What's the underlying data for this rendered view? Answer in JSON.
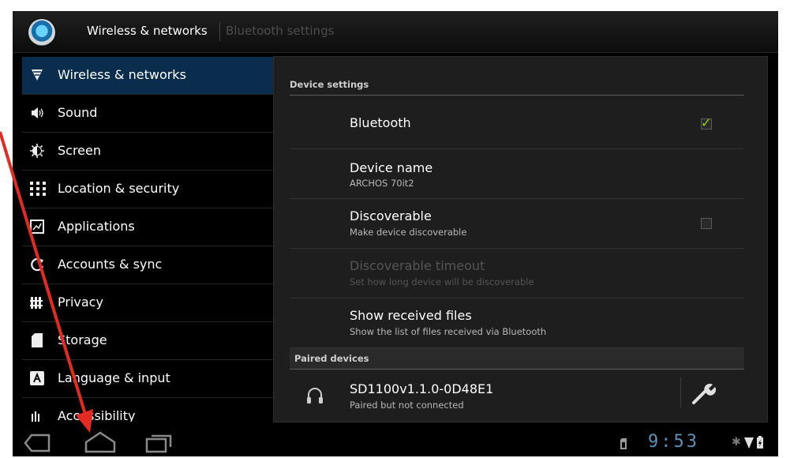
{
  "actionbar": {
    "title": "Wireless & networks",
    "subtitle": "Bluetooth settings",
    "app_icon": "settings-globe-icon"
  },
  "leftlist": {
    "items": [
      {
        "label": "Wireless & networks",
        "icon": "wifi-icon",
        "selected": true
      },
      {
        "label": "Sound",
        "icon": "speaker-icon"
      },
      {
        "label": "Screen",
        "icon": "brightness-icon"
      },
      {
        "label": "Location & security",
        "icon": "grid-icon"
      },
      {
        "label": "Applications",
        "icon": "applications-icon"
      },
      {
        "label": "Accounts & sync",
        "icon": "sync-icon"
      },
      {
        "label": "Privacy",
        "icon": "privacy-icon"
      },
      {
        "label": "Storage",
        "icon": "sdcard-icon"
      },
      {
        "label": "Language & input",
        "icon": "keyboard-icon"
      },
      {
        "label": "Accessibility",
        "icon": "accessibility-icon"
      }
    ]
  },
  "panel": {
    "device_settings_header": "Device settings",
    "bluetooth": {
      "title": "Bluetooth",
      "checked": true
    },
    "device_name": {
      "title": "Device name",
      "summary": "ARCHOS 70it2"
    },
    "discoverable": {
      "title": "Discoverable",
      "summary": "Make device discoverable",
      "checked": false
    },
    "discoverable_timeout": {
      "title": "Discoverable timeout",
      "summary": "Set how long device will be discoverable",
      "enabled": false
    },
    "received_files": {
      "title": "Show received files",
      "summary": "Show the list of files received via Bluetooth"
    },
    "paired_header": "Paired devices",
    "paired_device": {
      "name": "SD1100v1.1.0-0D48E1",
      "status": "Paired but not connected",
      "icon": "headset-icon",
      "settings_icon": "wrench-icon"
    }
  },
  "navbar": {
    "back_icon": "back-icon",
    "home_icon": "home-icon",
    "recents_icon": "recent-apps-icon",
    "clock": "9:53",
    "status_icons": [
      "sdcard-notification-icon",
      "bluetooth-icon",
      "wifi-signal-icon",
      "battery-icon"
    ]
  },
  "colors": {
    "selected_row": "#0b2d4d",
    "checkbox_tick": "#9bd21a",
    "clock": "#5c8fb8",
    "annotation_arrow": "#e32b24"
  }
}
